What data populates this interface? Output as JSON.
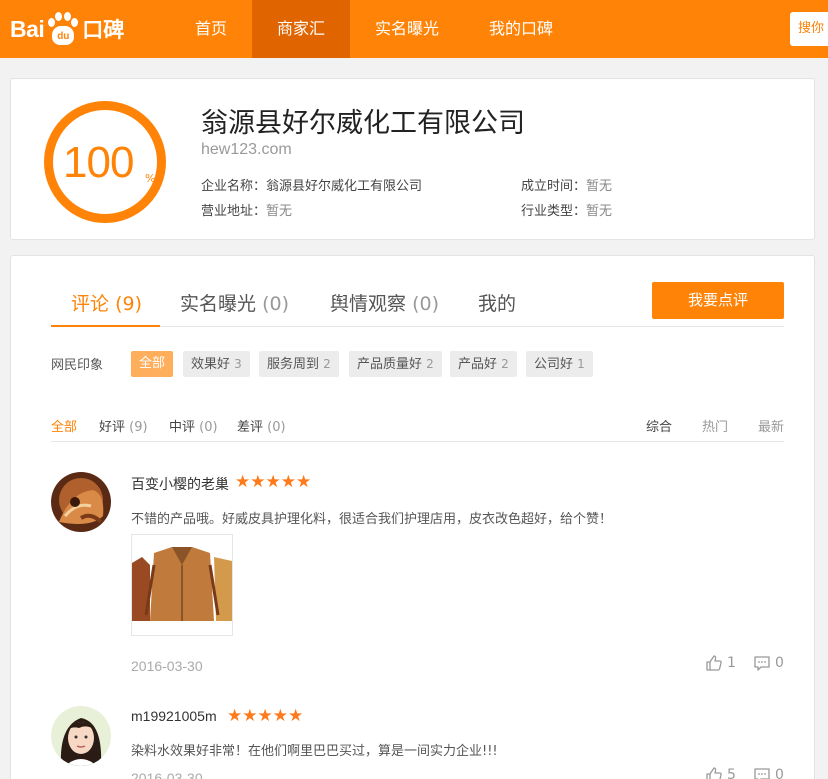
{
  "header": {
    "logo_bai": "Bai",
    "logo_du": "du",
    "logo_kb": "口碑",
    "nav": [
      {
        "label": "首页",
        "active": false
      },
      {
        "label": "商家汇",
        "active": true
      },
      {
        "label": "实名曝光",
        "active": false
      },
      {
        "label": "我的口碑",
        "active": false
      }
    ],
    "search_label": "搜你"
  },
  "company": {
    "score": "100",
    "score_unit": "%",
    "name": "翁源县好尔威化工有限公司",
    "url": "hew123.com",
    "info": {
      "name_label": "企业名称：",
      "name_value": "翁源县好尔威化工有限公司",
      "founded_label": "成立时间：",
      "founded_value": "暂无",
      "address_label": "营业地址：",
      "address_value": "暂无",
      "industry_label": "行业类型：",
      "industry_value": "暂无"
    }
  },
  "tabs": [
    {
      "label": "评论",
      "count": "(9)",
      "active": true
    },
    {
      "label": "实名曝光",
      "count": "(0)",
      "active": false
    },
    {
      "label": "舆情观察",
      "count": "(0)",
      "active": false
    },
    {
      "label": "我的",
      "count": "",
      "active": false
    }
  ],
  "comment_button": "我要点评",
  "impressions": {
    "label": "网民印象",
    "tags": [
      {
        "label": "全部",
        "count": "",
        "active": true
      },
      {
        "label": "效果好",
        "count": "3",
        "active": false
      },
      {
        "label": "服务周到",
        "count": "2",
        "active": false
      },
      {
        "label": "产品质量好",
        "count": "2",
        "active": false
      },
      {
        "label": "产品好",
        "count": "2",
        "active": false
      },
      {
        "label": "公司好",
        "count": "1",
        "active": false
      }
    ]
  },
  "filters": [
    {
      "label": "全部",
      "count": "",
      "active": true
    },
    {
      "label": "好评",
      "count": "(9)",
      "active": false
    },
    {
      "label": "中评",
      "count": "(0)",
      "active": false
    },
    {
      "label": "差评",
      "count": "(0)",
      "active": false
    }
  ],
  "sort": [
    {
      "label": "综合",
      "active": true
    },
    {
      "label": "热门",
      "active": false
    },
    {
      "label": "最新",
      "active": false
    }
  ],
  "reviews": [
    {
      "user": "百变小樱的老巢",
      "stars": "★★★★★",
      "rating": 5,
      "text": "不错的产品哦。好威皮具护理化料，很适合我们护理店用，皮衣改色超好，给个赞！",
      "date": "2016-03-30",
      "likes": "1",
      "comments": "0"
    },
    {
      "user": "m19921005m",
      "stars": "★★★★★",
      "rating": 5,
      "text": "染料水效果好非常！在他们啊里巴巴买过，算是一间实力企业!!!",
      "date": "2016-03-30",
      "likes": "5",
      "comments": "0"
    }
  ],
  "colors": {
    "brand": "#ff8307",
    "brand_dark": "#e06400",
    "star": "#ff7a1a"
  }
}
